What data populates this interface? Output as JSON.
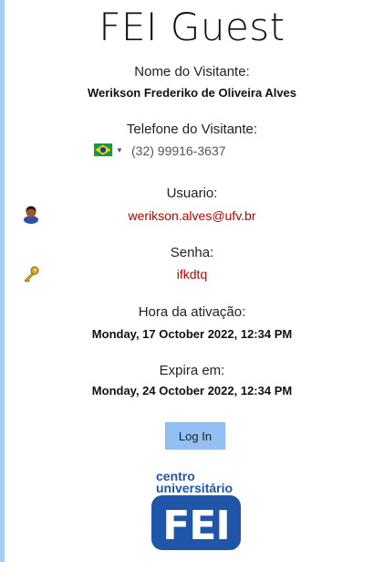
{
  "title": "FEI Guest",
  "visitor_name": {
    "label": "Nome do Visitante:",
    "value": "Werikson Frederiko de Oliveira Alves"
  },
  "phone": {
    "label": "Telefone do Visitante:",
    "value": "(32) 99916-3637",
    "country_flag": "brazil-flag-icon"
  },
  "user": {
    "label": "Usuario:",
    "value": "werikson.alves@ufv.br",
    "icon": "user-icon"
  },
  "password": {
    "label": "Senha:",
    "value": "ifkdtq",
    "icon": "key-icon"
  },
  "activation": {
    "label": "Hora da ativação:",
    "value": "Monday, 17 October 2022, 12:34 PM"
  },
  "expires": {
    "label": "Expira em:",
    "value": "Monday, 24 October 2022, 12:34 PM"
  },
  "login_button": "Log In",
  "logo": {
    "line1": "centro",
    "line2": "universitário",
    "brand": "FEI"
  },
  "colors": {
    "accent": "#93c0f2",
    "red": "#c00000",
    "logo_blue": "#1f56a8"
  }
}
